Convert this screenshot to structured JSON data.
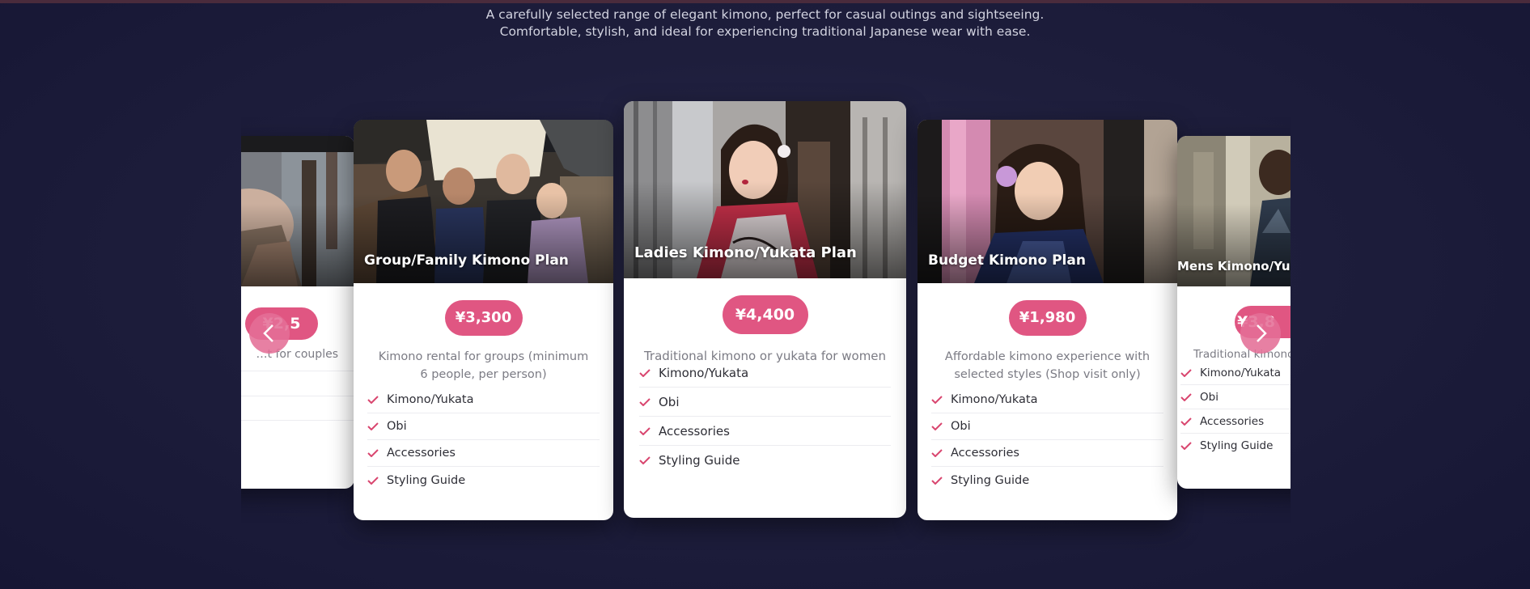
{
  "subtitle": {
    "line1": "A carefully selected range of elegant kimono, perfect for casual outings and sightseeing.",
    "line2": "Comfortable, stylish, and ideal for experiencing traditional Japanese wear with ease."
  },
  "colors": {
    "accent": "#e05682",
    "check": "#d9466f",
    "background": "#1e1e3c"
  },
  "carousel": {
    "prev_icon": "chevron-left-icon",
    "next_icon": "chevron-right-icon",
    "plans": [
      {
        "title": "",
        "price": "¥2,5",
        "description": "…t for couples",
        "features": [
          "",
          "",
          ""
        ]
      },
      {
        "title": "Group/Family Kimono Plan",
        "price": "¥3,300",
        "description": "Kimono rental for groups (minimum 6 people, per person)",
        "features": [
          "Kimono/Yukata",
          "Obi",
          "Accessories",
          "Styling Guide"
        ]
      },
      {
        "title": "Ladies Kimono/Yukata Plan",
        "price": "¥4,400",
        "description": "Traditional kimono or yukata for women",
        "features": [
          "Kimono/Yukata",
          "Obi",
          "Accessories",
          "Styling Guide"
        ]
      },
      {
        "title": "Budget Kimono Plan",
        "price": "¥1,980",
        "description": "Affordable kimono experience with selected styles (Shop visit only)",
        "features": [
          "Kimono/Yukata",
          "Obi",
          "Accessories",
          "Styling Guide"
        ]
      },
      {
        "title": "Mens Kimono/Yukata Plan",
        "price": "¥3,8",
        "description": "Traditional kimono",
        "features": [
          "Kimono/Yukata",
          "Obi",
          "Accessories",
          "Styling Guide"
        ]
      }
    ]
  }
}
